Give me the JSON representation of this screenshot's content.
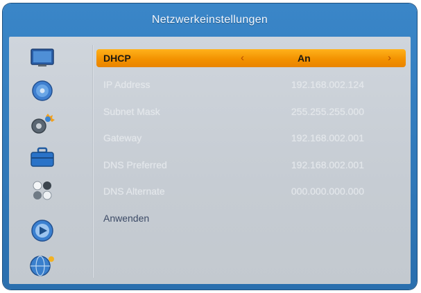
{
  "window": {
    "title": "Netzwerkeinstellungen"
  },
  "colors": {
    "frame": "#2f7cc0",
    "panel": "#c9cfd5",
    "highlight": "#f39200"
  },
  "sidebar": {
    "icons": [
      "tv-icon",
      "disc-icon",
      "settings-gear-icon",
      "toolbox-icon",
      "dots-grid-icon",
      "media-disc-icon",
      "globe-network-icon"
    ]
  },
  "network": {
    "dhcp": {
      "label": "DHCP",
      "value": "An",
      "left_arrow": "‹",
      "right_arrow": "›"
    },
    "ip": {
      "label": "IP Address",
      "value": "192.168.002.124"
    },
    "subnet": {
      "label": "Subnet Mask",
      "value": "255.255.255.000"
    },
    "gateway": {
      "label": "Gateway",
      "value": "192.168.002.001"
    },
    "dns_preferred": {
      "label": "DNS Preferred",
      "value": "192.168.002.001"
    },
    "dns_alternate": {
      "label": "DNS Alternate",
      "value": "000.000.000.000"
    },
    "apply_label": "Anwenden"
  }
}
